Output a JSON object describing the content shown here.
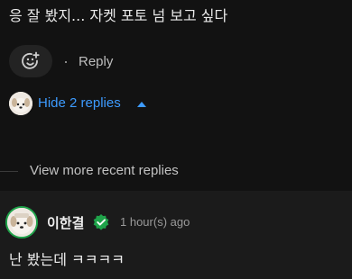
{
  "comment": {
    "text": "응 잘 봤지... 자켓 포토 넘 보고 싶다"
  },
  "actions": {
    "reply_label": "Reply",
    "react_icon": "add-reaction-icon"
  },
  "thread": {
    "hide_replies_label": "Hide 2 replies",
    "toggle_icon": "caret-up-icon",
    "view_more_label": "View more recent replies"
  },
  "reply": {
    "author": "이한결",
    "verified_icon": "verified-badge-icon",
    "timestamp": "1 hour(s) ago",
    "text": "난 봤는데 ㅋㅋㅋㅋ"
  },
  "colors": {
    "link_blue": "#3d9bff",
    "verified_green": "#1fa34a",
    "background_top": "#121212",
    "background_reply": "#1b1b1b"
  }
}
